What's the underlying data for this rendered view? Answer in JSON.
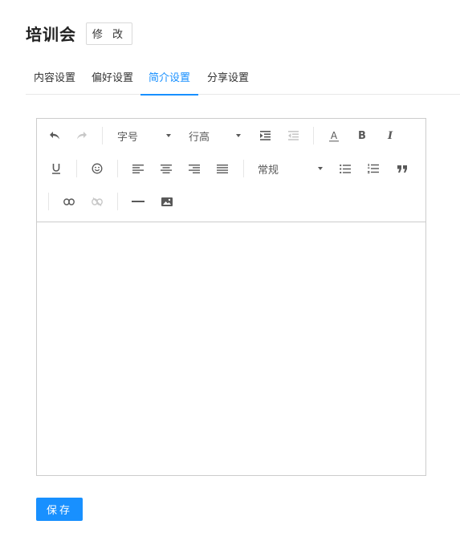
{
  "header": {
    "title": "培训会",
    "edit_label": "修 改"
  },
  "tabs": [
    {
      "label": "内容设置",
      "active": false
    },
    {
      "label": "偏好设置",
      "active": false
    },
    {
      "label": "简介设置",
      "active": true
    },
    {
      "label": "分享设置",
      "active": false
    }
  ],
  "toolbar": {
    "font_size_select": "字号",
    "line_height_select": "行高",
    "paragraph_select": "常规",
    "bold": "B",
    "italic": "I",
    "underline": "U",
    "font_color": "A",
    "icons": [
      "undo-icon",
      "redo-icon",
      "indent-icon",
      "outdent-icon",
      "font-color-icon",
      "bold-icon",
      "italic-icon",
      "underline-icon",
      "emoji-icon",
      "align-left-icon",
      "align-center-icon",
      "align-right-icon",
      "align-justify-icon",
      "bullet-list-icon",
      "numbered-list-icon",
      "quote-icon",
      "link-icon",
      "unlink-icon",
      "horizontal-rule-icon",
      "image-icon"
    ]
  },
  "editor": {
    "content": ""
  },
  "footer": {
    "save_label": "保存"
  },
  "colors": {
    "accent": "#1890ff",
    "border": "#cccccc",
    "icon": "#595959",
    "icon_disabled": "#c8c8c8"
  }
}
